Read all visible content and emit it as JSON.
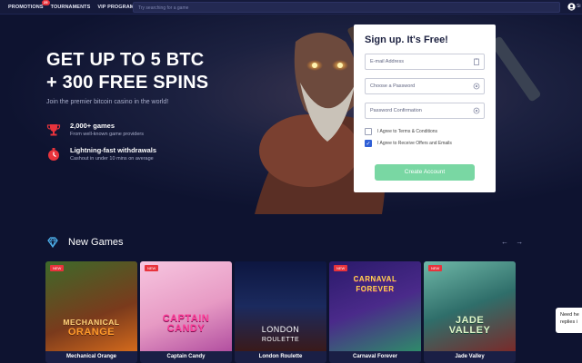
{
  "topbar": {
    "nav": [
      {
        "label": "PROMOTIONS",
        "badge": "25"
      },
      {
        "label": "TOURNAMENTS"
      },
      {
        "label": "VIP PROGRAM"
      }
    ],
    "search_placeholder": "Try searching for a game",
    "user_short": "Si"
  },
  "hero": {
    "title_line1": "GET UP TO 5 BTC",
    "title_line2": "+ 300 FREE SPINS",
    "subtitle": "Join the premier bitcoin casino in the world!",
    "features": [
      {
        "icon": "trophy-icon",
        "title": "2,000+ games",
        "sub": "From well-known game providers"
      },
      {
        "icon": "stopwatch-icon",
        "title": "Lightning-fast withdrawals",
        "sub": "Cashout in under 10 mins on average"
      }
    ]
  },
  "signup": {
    "title": "Sign up. It's Free!",
    "email_placeholder": "E-mail Address",
    "password_placeholder": "Choose a Password",
    "confirm_placeholder": "Password Confirmation",
    "terms_label": "I Agree to Terms & Conditions",
    "offers_label": "I Agree to Receive Offers and Emails",
    "terms_checked": false,
    "offers_checked": true,
    "button_label": "Create Account"
  },
  "new_games": {
    "title": "New Games",
    "prev": "←",
    "next": "→",
    "games": [
      {
        "name": "Mechanical Orange",
        "art_line1": "MECHANICAL",
        "art_line2": "ORANGE",
        "tag": "NEW",
        "bg": "#7a3a1c"
      },
      {
        "name": "Captain Candy",
        "art_line1": "CAPTAIN",
        "art_line2": "CANDY",
        "tag": "NEW",
        "bg": "#e79ac4"
      },
      {
        "name": "London Roulette",
        "art_line1": "LONDON",
        "art_line2": "ROULETTE",
        "tag": "",
        "bg": "#1b2a5e"
      },
      {
        "name": "Carnaval Forever",
        "art_line1": "CARNAVAL",
        "art_line2": "FOREVER",
        "tag": "NEW",
        "bg": "#4a2a8a"
      },
      {
        "name": "Jade Valley",
        "art_line1": "JADE",
        "art_line2": "VALLEY",
        "tag": "NEW",
        "bg": "#2f6e6a"
      }
    ]
  },
  "chat": {
    "line1": "Need he",
    "line2": "replies i"
  }
}
